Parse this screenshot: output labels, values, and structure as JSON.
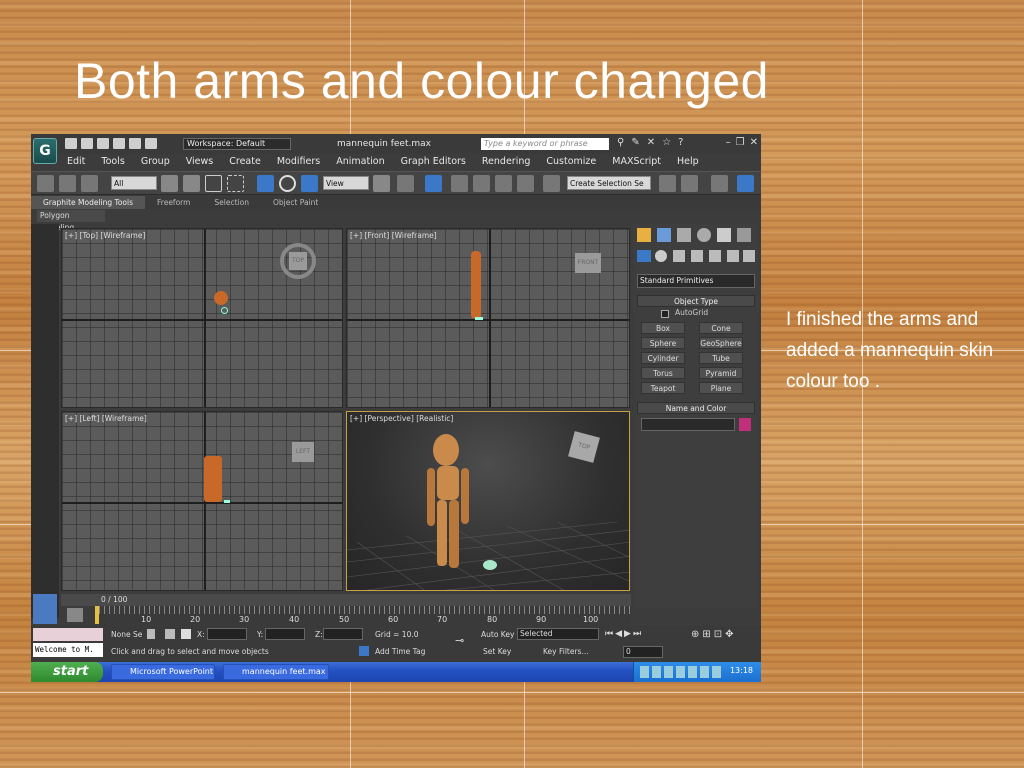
{
  "slide": {
    "title": "Both arms and colour changed",
    "body_text": "I finished the arms and added a mannequin skin colour too ."
  },
  "app": {
    "window_title": "mannequin feet.max",
    "workspace_label": "Workspace: Default",
    "search_placeholder": "Type a keyword or phrase",
    "menu": [
      "Edit",
      "Tools",
      "Group",
      "Views",
      "Create",
      "Modifiers",
      "Animation",
      "Graph Editors",
      "Rendering",
      "Customize",
      "MAXScript",
      "Help"
    ],
    "toolbar": {
      "filter_value": "All",
      "view_value": "View",
      "selection_set_placeholder": "Create Selection Se"
    },
    "ribbon_tabs": [
      "Graphite Modeling Tools",
      "Freeform",
      "Selection",
      "Object Paint"
    ],
    "ribbon_sub": "Polygon Modeling",
    "viewports": {
      "top": "[+] [Top] [Wireframe]",
      "front": "[+] [Front] [Wireframe]",
      "left": "[+] [Left] [Wireframe]",
      "perspective": "[+] [Perspective] [Realistic]"
    },
    "view_cube_labels": {
      "top": "TOP",
      "front": "FRONT",
      "left": "LEFT",
      "persp": "TOP"
    },
    "command_panel": {
      "category": "Standard Primitives",
      "object_type_header": "Object Type",
      "autogrid": "AutoGrid",
      "buttons": [
        "Box",
        "Cone",
        "Sphere",
        "GeoSphere",
        "Cylinder",
        "Tube",
        "Torus",
        "Pyramid",
        "Teapot",
        "Plane"
      ],
      "name_color_header": "Name and Color",
      "color_swatch": "#c0307a"
    },
    "timeline": {
      "frame_label": "0 / 100",
      "ticks": [
        "10",
        "20",
        "30",
        "40",
        "50",
        "60",
        "70",
        "80",
        "90",
        "100"
      ]
    },
    "status": {
      "selection": "None Se",
      "welcome": "Welcome to M.",
      "prompt": "Click and drag to select and move objects",
      "x_label": "X:",
      "y_label": "Y:",
      "z_label": "Z:",
      "grid": "Grid = 10.0",
      "add_time_tag": "Add Time Tag",
      "auto_key": "Auto Key",
      "set_key": "Set Key",
      "key_mode": "Selected",
      "key_filters": "Key Filters...",
      "frame_field": "0"
    },
    "taskbar": {
      "start": "start",
      "tasks": [
        "Microsoft PowerPoint ...",
        "mannequin feet.max ..."
      ],
      "clock": "13:18"
    },
    "colors": {
      "figure": "#c8692a",
      "figure_persp": "#c98a4c",
      "accent_blue": "#3c78c8"
    }
  }
}
